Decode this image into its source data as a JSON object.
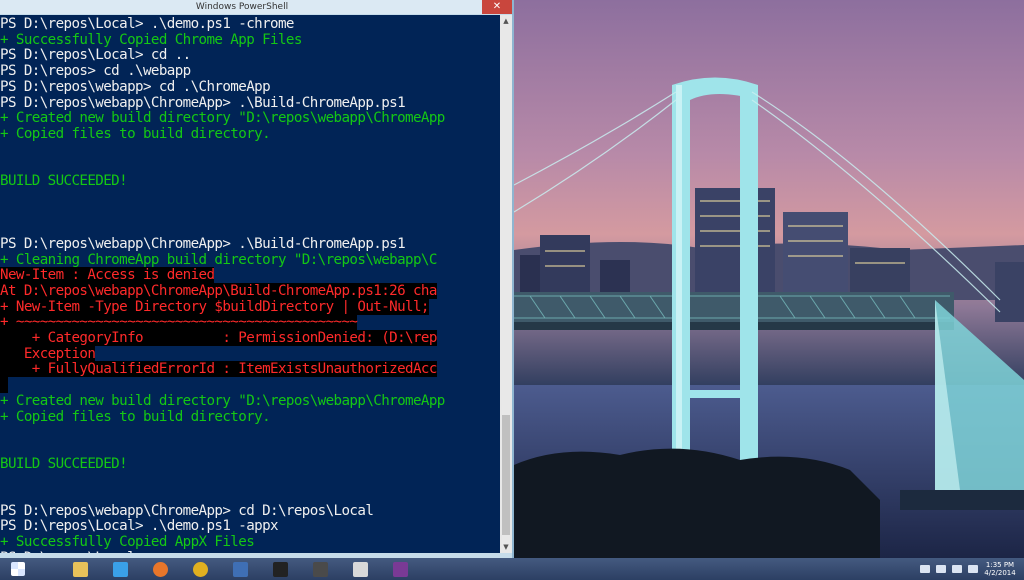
{
  "window": {
    "title": "Windows PowerShell",
    "close_label": "✕"
  },
  "console": {
    "lines": [
      {
        "type": "prompt",
        "text": "PS D:\\repos\\Local> .\\demo.ps1 -chrome"
      },
      {
        "type": "ok",
        "text": "+ Successfully Copied Chrome App Files"
      },
      {
        "type": "prompt",
        "text": "PS D:\\repos\\Local> cd .."
      },
      {
        "type": "prompt",
        "text": "PS D:\\repos> cd .\\webapp"
      },
      {
        "type": "prompt",
        "text": "PS D:\\repos\\webapp> cd .\\ChromeApp"
      },
      {
        "type": "prompt",
        "text": "PS D:\\repos\\webapp\\ChromeApp> .\\Build-ChromeApp.ps1"
      },
      {
        "type": "ok",
        "text": "+ Created new build directory \"D:\\repos\\webapp\\ChromeApp"
      },
      {
        "type": "ok",
        "text": "+ Copied files to build directory."
      },
      {
        "type": "blank",
        "text": ""
      },
      {
        "type": "blank",
        "text": ""
      },
      {
        "type": "ok",
        "text": "BUILD SUCCEEDED!"
      },
      {
        "type": "blank",
        "text": ""
      },
      {
        "type": "blank",
        "text": ""
      },
      {
        "type": "blank",
        "text": ""
      },
      {
        "type": "prompt",
        "text": "PS D:\\repos\\webapp\\ChromeApp> .\\Build-ChromeApp.ps1"
      },
      {
        "type": "ok",
        "text": "+ Cleaning ChromeApp build directory \"D:\\repos\\webapp\\C"
      },
      {
        "type": "err",
        "text": "New-Item : Access is denied"
      },
      {
        "type": "err",
        "text": "At D:\\repos\\webapp\\ChromeApp\\Build-ChromeApp.ps1:26 cha"
      },
      {
        "type": "err",
        "text": "+ New-Item -Type Directory $buildDirectory | Out-Null;"
      },
      {
        "type": "err",
        "text": "+ ~~~~~~~~~~~~~~~~~~~~~~~~~~~~~~~~~~~~~~~~~~~"
      },
      {
        "type": "err",
        "text": "    + CategoryInfo          : PermissionDenied: (D:\\rep"
      },
      {
        "type": "err",
        "text": "   Exception"
      },
      {
        "type": "err",
        "text": "    + FullyQualifiedErrorId : ItemExistsUnauthorizedAcc"
      },
      {
        "type": "err",
        "text": " "
      },
      {
        "type": "ok",
        "text": "+ Created new build directory \"D:\\repos\\webapp\\ChromeApp"
      },
      {
        "type": "ok",
        "text": "+ Copied files to build directory."
      },
      {
        "type": "blank",
        "text": ""
      },
      {
        "type": "blank",
        "text": ""
      },
      {
        "type": "ok",
        "text": "BUILD SUCCEEDED!"
      },
      {
        "type": "blank",
        "text": ""
      },
      {
        "type": "blank",
        "text": ""
      },
      {
        "type": "prompt",
        "text": "PS D:\\repos\\webapp\\ChromeApp> cd D:\\repos\\Local"
      },
      {
        "type": "prompt",
        "text": "PS D:\\repos\\Local> .\\demo.ps1 -appx"
      },
      {
        "type": "ok",
        "text": "+ Successfully Copied AppX Files"
      },
      {
        "type": "prompt",
        "text": "PS D:\\repos\\Local>"
      }
    ],
    "colors": {
      "background": "#012456",
      "prompt": "#f0f0f0",
      "success": "#14c814",
      "error": "#ff2a2a"
    }
  },
  "taskbar": {
    "items": [
      {
        "name": "start-icon",
        "color": "#ffffff"
      },
      {
        "name": "file-explorer-icon",
        "color": "#e8c25a"
      },
      {
        "name": "internet-explorer-icon",
        "color": "#3aa0e8"
      },
      {
        "name": "firefox-icon",
        "color": "#e8762a"
      },
      {
        "name": "chrome-icon",
        "color": "#e0b020"
      },
      {
        "name": "powershell-icon",
        "color": "#3f6fb5"
      },
      {
        "name": "github-icon",
        "color": "#222222"
      },
      {
        "name": "sublime-text-icon",
        "color": "#4a4a4a"
      },
      {
        "name": "windows-store-icon",
        "color": "#d9d9d9"
      },
      {
        "name": "visual-studio-icon",
        "color": "#7a3a95"
      }
    ],
    "clock": {
      "time": "1:35 PM",
      "date": "4/2/2014"
    }
  }
}
